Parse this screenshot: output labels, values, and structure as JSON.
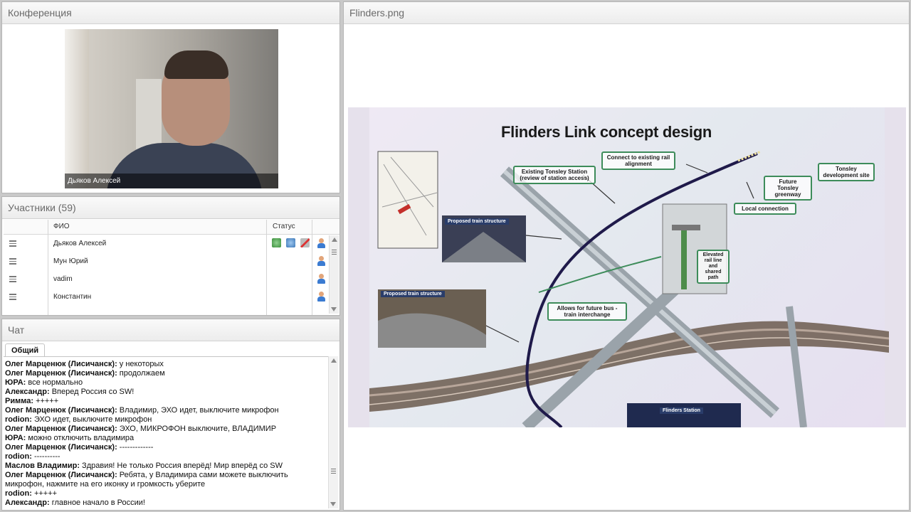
{
  "conference": {
    "title": "Конференция",
    "video_caption": "Дьяков Алексей"
  },
  "participants": {
    "title": "Участники (59)",
    "col_name": "ФИО",
    "col_status": "Статус",
    "rows": [
      {
        "name": "Дьяков Алексей"
      },
      {
        "name": "Мун Юрий"
      },
      {
        "name": "vadim"
      },
      {
        "name": "Константин"
      }
    ]
  },
  "chat": {
    "title": "Чат",
    "tab": "Общий",
    "messages": [
      {
        "author": "Олег Марценюк (Лисичанск):",
        "text": " у некоторых"
      },
      {
        "author": "Олег Марценюк (Лисичанск):",
        "text": " продолжаем"
      },
      {
        "author": "ЮРА:",
        "text": " все  нормально"
      },
      {
        "author": "Александр:",
        "text": " Вперед Россия со SW!"
      },
      {
        "author": "Римма:",
        "text": " +++++"
      },
      {
        "author": "Олег Марценюк (Лисичанск):",
        "text": " Владимир, ЭХО идет, выключите микрофон"
      },
      {
        "author": "rodion:",
        "text": " ЭХО идет, выключите микрофон"
      },
      {
        "author": "Олег Марценюк (Лисичанск):",
        "text": " ЭХО, МИКРОФОН выключите, ВЛАДИМИР"
      },
      {
        "author": "ЮРА:",
        "text": " можно отключить  владимира"
      },
      {
        "author": "Олег Марценюк (Лисичанск):",
        "text": " -------------"
      },
      {
        "author": "rodion:",
        "text": " ----------"
      },
      {
        "author": "Маслов Владимир:",
        "text": " Здравия! Не только Россия вперёд! Мир вперёд со SW"
      },
      {
        "author": "Олег Марценюк (Лисичанск):",
        "text": " Ребята, у Владимира сами можете выключить микрофон, нажмите на его иконку и громкость уберите"
      },
      {
        "author": "rodion:",
        "text": " +++++"
      },
      {
        "author": "Александр:",
        "text": " главное начало в России!"
      }
    ]
  },
  "document": {
    "title": "Flinders.png",
    "slide": {
      "title": "Flinders Link concept design",
      "labels": {
        "connect": "Connect to existing rail alignment",
        "tonsley_station": "Existing Tonsley Station (review of station access)",
        "greenway": "Future Tonsley greenway",
        "development": "Tonsley development site",
        "local": "Local connection",
        "train_structure_1": "Proposed train structure",
        "train_structure_2": "Proposed train structure",
        "elevated": "Elevated rail line and shared path",
        "interchange": "Allows for future bus - train interchange",
        "flinders_station": "Flinders Station"
      }
    }
  },
  "colors": {
    "accent_green": "#3d8c5a",
    "rail_dark": "#1f1a4a",
    "panel_border": "#b5b5b5"
  }
}
